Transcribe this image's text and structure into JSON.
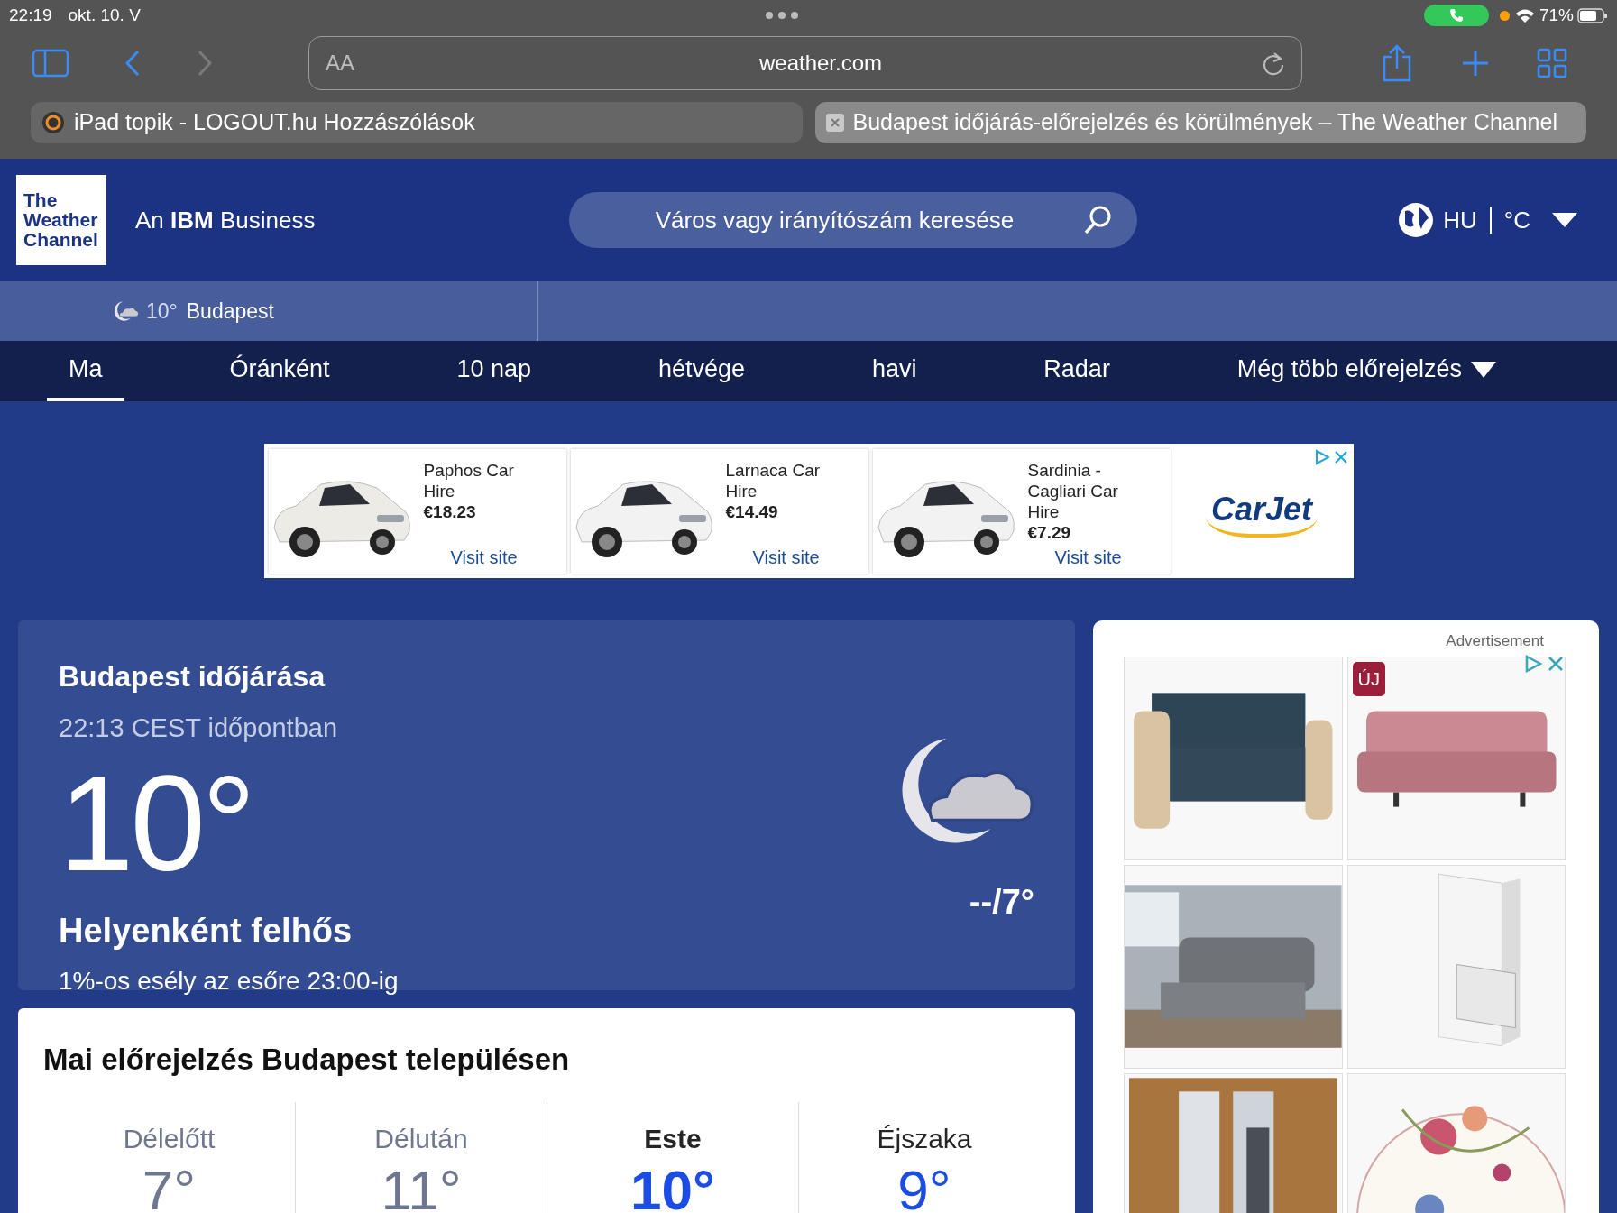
{
  "status_bar": {
    "time": "22:19",
    "date": "okt. 10. V",
    "battery": "71%"
  },
  "browser": {
    "address_hint": "AA",
    "url": "weather.com",
    "tabs": [
      {
        "title": "iPad topik - LOGOUT.hu Hozzászólások",
        "selected": false
      },
      {
        "title": "Budapest időjárás-előrejelzés és körülmények – The Weather Channel",
        "selected": true
      }
    ]
  },
  "header": {
    "logo": [
      "The",
      "Weather",
      "Channel"
    ],
    "tagline": "An **IBM** Business",
    "search": {
      "placeholder": "Város vagy irányítószám keresése"
    },
    "language": "HU",
    "unit": "°C"
  },
  "location_bar": {
    "temperature": "10°",
    "city": "Budapest"
  },
  "nav": [
    {
      "label": "Ma",
      "selected": true
    },
    {
      "label": "Óránként",
      "selected": false
    },
    {
      "label": "10 nap",
      "selected": false
    },
    {
      "label": "hétvége",
      "selected": false
    },
    {
      "label": "havi",
      "selected": false
    },
    {
      "label": "Radar",
      "selected": false
    },
    {
      "label": "Még több előrejelzés",
      "selected": false
    }
  ],
  "ad_banner": {
    "items": [
      {
        "title": "Paphos Car Hire",
        "price": "€18.23",
        "link": "Visit site"
      },
      {
        "title": "Larnaca Car Hire",
        "price": "€14.49",
        "link": "Visit site"
      },
      {
        "title": "Sardinia - Cagliari Car Hire",
        "price": "€7.29",
        "link": "Visit site"
      }
    ],
    "brand": "CarJet"
  },
  "current": {
    "title": "Budapest időjárása",
    "time": "22:13 CEST időpontban",
    "temperature": "10°",
    "condition": "Helyenként felhős",
    "precipitation": "1%-os esély az esőre 23:00-ig",
    "high_low": "--/7°"
  },
  "side_ad": {
    "label": "Advertisement",
    "badge": "ÚJ"
  },
  "forecast": {
    "title": "Mai előrejelzés Budapest településen",
    "periods": [
      {
        "label": "Délelőtt",
        "temperature": "7°",
        "past": true,
        "selected": false
      },
      {
        "label": "Délután",
        "temperature": "11°",
        "past": true,
        "selected": false
      },
      {
        "label": "Este",
        "temperature": "10°",
        "past": false,
        "selected": true
      },
      {
        "label": "Éjszaka",
        "temperature": "9°",
        "past": false,
        "selected": false
      }
    ]
  }
}
